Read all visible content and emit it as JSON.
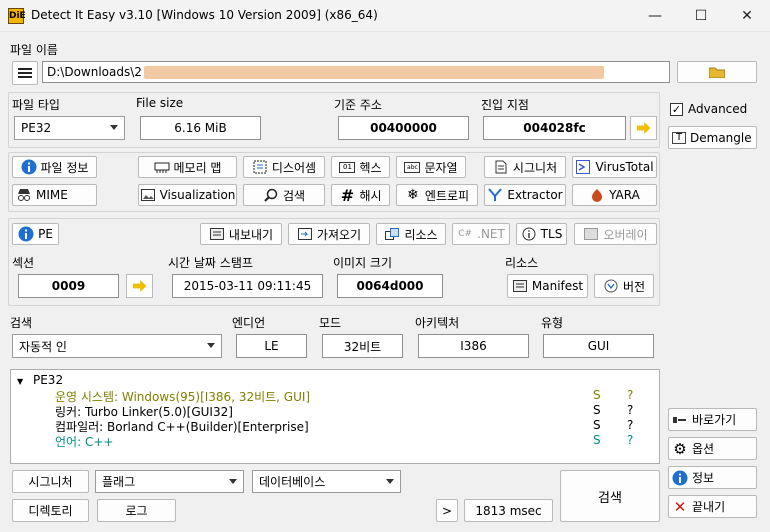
{
  "window": {
    "title": "Detect It Easy v3.10 [Windows 10 Version 2009] (x86_64)",
    "app_icon_text": "DiE",
    "min_glyph": "—",
    "max_glyph": "☐",
    "close_glyph": "✕"
  },
  "file": {
    "label": "파일 이름",
    "path": "D:\\Downloads\\2"
  },
  "info": {
    "file_type_label": "파일 타입",
    "file_type_value": "PE32",
    "file_size_label": "File size",
    "file_size_value": "6.16 MiB",
    "base_address_label": "기준 주소",
    "base_address_value": "00400000",
    "entry_point_label": "진입 지점",
    "entry_point_value": "004028fc"
  },
  "side": {
    "advanced_label": "Advanced",
    "advanced_checked": "✓",
    "demangle_label": "Demangle",
    "shortcuts_label": "바로가기",
    "options_label": "옵션",
    "about_label": "정보",
    "exit_label": "끝내기"
  },
  "tools": {
    "file_info": "파일 정보",
    "memory_map": "메모리 맵",
    "disasm": "디스어셈",
    "hex": "헥스",
    "strings": "문자열",
    "signatures": "시그니처",
    "virustotal": "VirusTotal",
    "mime": "MIME",
    "visualization": "Visualization",
    "search": "검색",
    "hash": "해시",
    "entropy": "엔트로피",
    "extractor": "Extractor",
    "yara": "YARA"
  },
  "pe": {
    "pe_label": "PE",
    "export": "내보내기",
    "import": "가져오기",
    "resources": "리소스",
    "net": ".NET",
    "tls": "TLS",
    "overlay": "오버레이",
    "sections_label": "섹션",
    "sections_value": "0009",
    "timestamp_label": "시간 날짜 스탬프",
    "timestamp_value": "2015-03-11 09:11:45",
    "image_size_label": "이미지 크기",
    "image_size_value": "0064d000",
    "resources_label": "리소스",
    "manifest": "Manifest",
    "version": "버전"
  },
  "scan": {
    "search_label": "검색",
    "search_value": "자동적 인",
    "endian_label": "엔디언",
    "endian_value": "LE",
    "mode_label": "모드",
    "mode_value": "32비트",
    "arch_label": "아키텍처",
    "arch_value": "I386",
    "type_label": "유형",
    "type_value": "GUI"
  },
  "results": {
    "root": "PE32",
    "rows": [
      {
        "text": "운영 시스템: Windows(95)[I386, 32비트, GUI]",
        "s": "S",
        "q": "?",
        "color": "#808000"
      },
      {
        "text": "링커: Turbo Linker(5.0)[GUI32]",
        "s": "S",
        "q": "?",
        "color": "#000000"
      },
      {
        "text": "컴파일러: Borland C++(Builder)[Enterprise]",
        "s": "S",
        "q": "?",
        "color": "#000000"
      },
      {
        "text": "언어: C++",
        "s": "S",
        "q": "?",
        "color": "#008b8b"
      }
    ]
  },
  "bottom": {
    "signatures": "시그니처",
    "flags": "플래그",
    "database": "데이터베이스",
    "directory": "디렉토리",
    "log": "로그",
    "more": ">",
    "time": "1813 msec",
    "scan": "검색"
  }
}
